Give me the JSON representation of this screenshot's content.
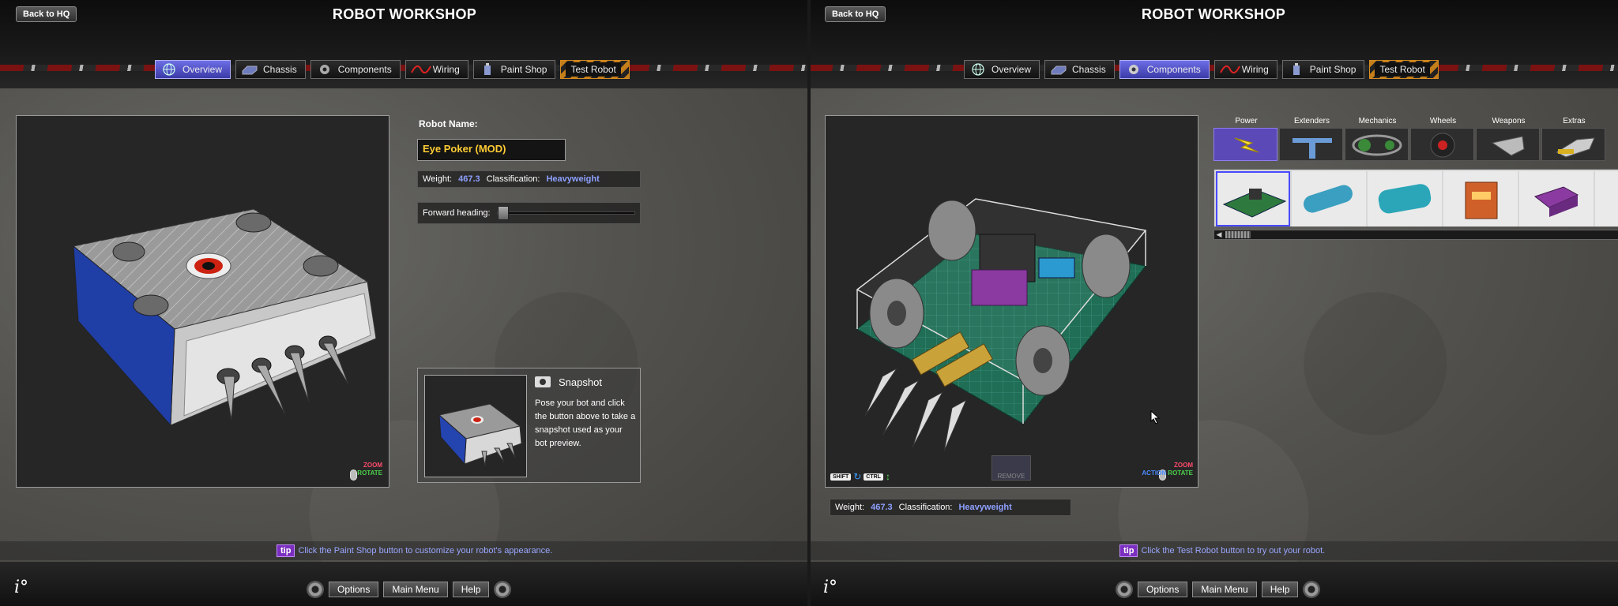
{
  "left": {
    "back_label": "Back to HQ",
    "title": "ROBOT WORKSHOP",
    "tabs": [
      {
        "label": "Overview"
      },
      {
        "label": "Chassis"
      },
      {
        "label": "Components"
      },
      {
        "label": "Wiring"
      },
      {
        "label": "Paint Shop"
      },
      {
        "label": "Test Robot"
      }
    ],
    "active_tab": "Overview",
    "robot_name_label": "Robot Name:",
    "robot_name_value": "Eye Poker (MOD)",
    "weight_label": "Weight:",
    "weight_value": "467.3",
    "classification_label": "Classification:",
    "classification_value": "Heavyweight",
    "forward_heading_label": "Forward heading:",
    "zoom_hint": "ZOOM",
    "rotate_hint": "ROTATE",
    "snapshot": {
      "title": "Snapshot",
      "text": "Pose your bot and click the button above to take a snapshot used as your bot preview."
    },
    "tip_badge": "tip",
    "tip_text": "Click the Paint Shop button to customize your robot's appearance.",
    "bottom": {
      "options": "Options",
      "main_menu": "Main Menu",
      "help": "Help"
    }
  },
  "right": {
    "back_label": "Back to HQ",
    "title": "ROBOT WORKSHOP",
    "tabs": [
      {
        "label": "Overview"
      },
      {
        "label": "Chassis"
      },
      {
        "label": "Components"
      },
      {
        "label": "Wiring"
      },
      {
        "label": "Paint Shop"
      },
      {
        "label": "Test Robot"
      }
    ],
    "active_tab": "Components",
    "categories": [
      "Power",
      "Extenders",
      "Mechanics",
      "Wheels",
      "Weapons",
      "Extras"
    ],
    "active_category": "Power",
    "weight_label": "Weight:",
    "weight_value": "467.3",
    "classification_label": "Classification:",
    "classification_value": "Heavyweight",
    "remove_label": "REMOVE",
    "shift_key": "SHIFT",
    "ctrl_key": "CTRL",
    "action_hint": "ACTION",
    "zoom_hint": "ZOOM",
    "rotate_hint": "ROTATE",
    "tip_badge": "tip",
    "tip_text": "Click the Test Robot button to try out your robot.",
    "bottom": {
      "options": "Options",
      "main_menu": "Main Menu",
      "help": "Help"
    }
  },
  "colors": {
    "active_tab": "#4a4ac0",
    "name_text": "#ffcc33",
    "stat_value": "#8da0ff",
    "tip_text": "#9aa6ff",
    "tip_badge": "#7b2fbf"
  }
}
